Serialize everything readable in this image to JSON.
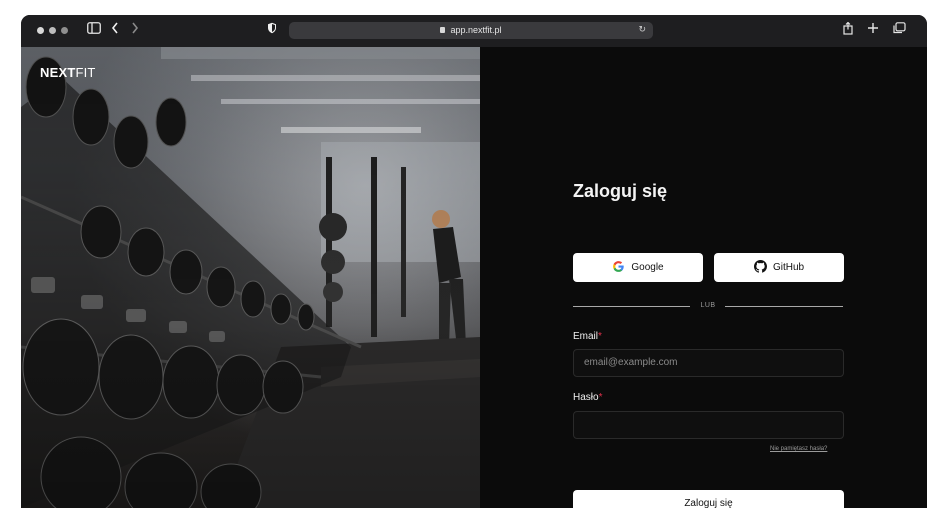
{
  "browser": {
    "url": "app.nextfit.pl",
    "icons": [
      "sidebar-icon",
      "back-icon",
      "forward-icon",
      "shield-icon",
      "lock-icon",
      "reload-icon",
      "share-icon",
      "new-tab-icon",
      "tabs-icon"
    ]
  },
  "brand": {
    "name_bold": "NEXT",
    "name_light": "FIT"
  },
  "login": {
    "title": "Zaloguj się",
    "google_label": "Google",
    "github_label": "GitHub",
    "divider_label": "LUB",
    "email_label": "Email",
    "email_placeholder": "email@example.com",
    "password_label": "Hasło",
    "required_mark": "*",
    "forgot_label": "Nie pamiętasz hasła?",
    "submit_label": "Zaloguj się"
  },
  "colors": {
    "panel_bg": "#0b0b0b",
    "required": "#e0314b",
    "button_bg": "#ffffff"
  }
}
